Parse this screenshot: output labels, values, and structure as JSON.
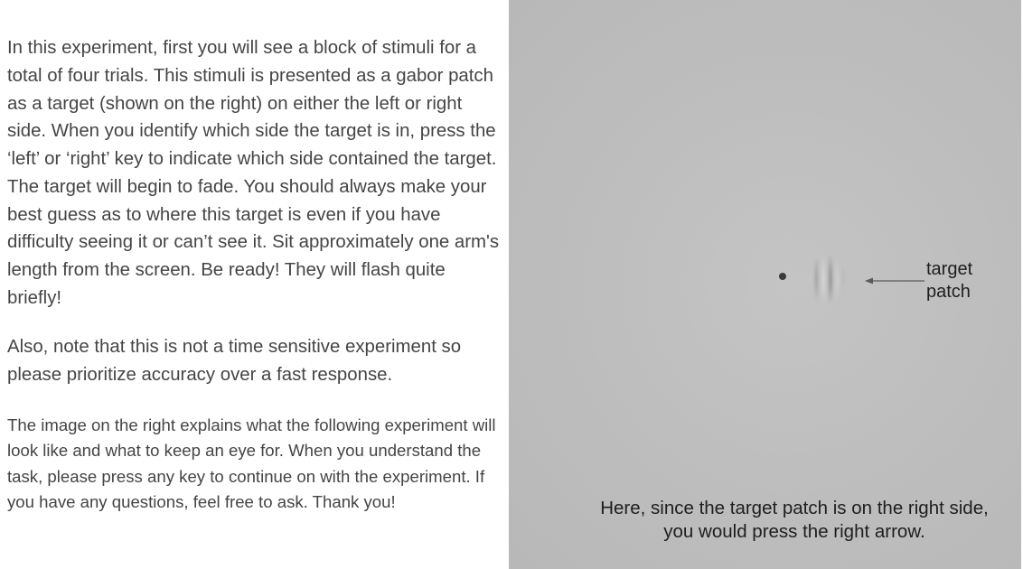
{
  "instructions": {
    "paragraph_1": "In this experiment, first you will see a block of stimuli for a total of four trials. This stimuli is presented as a gabor patch as a target (shown on the right) on either the left or right side. When you identify which side the target is in, press the ‘left’ or ‘right’ key to indicate which side contained the target. The target will begin to fade. You should always make your best guess as to where this target is even if you have difficulty seeing it or can’t see it. Sit approximately one arm's length from the screen. Be ready!  They will flash quite briefly!",
    "paragraph_2": "Also, note that this is not a time sensitive experiment so please prioritize accuracy over a fast response.",
    "paragraph_3": "The image on the right explains what the following experiment will look like and what to keep an eye for. When you understand the task, please press any key to continue on with the experiment. If you have any questions, feel free to ask. Thank you!"
  },
  "example_image": {
    "target_label_line1": "target",
    "target_label_line2": "patch",
    "caption_line1": "Here, since the target patch is on the right side,",
    "caption_line2": "you would press the right arrow.",
    "fixation_icon": "fixation-dot",
    "stimulus_icon": "gabor-patch",
    "pointer_icon": "left-arrow-icon"
  },
  "colors": {
    "text": "#454545",
    "panel_background": "#bdbdbd",
    "label_text": "#1e1e1e"
  }
}
